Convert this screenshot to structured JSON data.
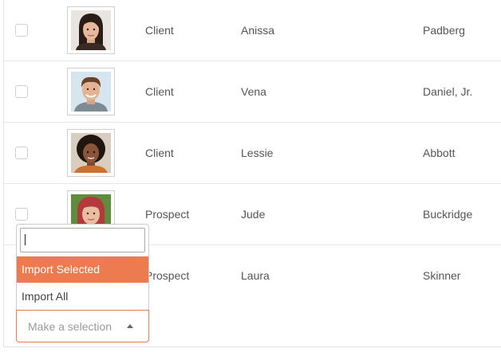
{
  "rows": [
    {
      "type": "Client",
      "first_name": "Anissa",
      "last_name": "Padberg",
      "photo": "woman-dark-hair-avatar"
    },
    {
      "type": "Client",
      "first_name": "Vena",
      "last_name": "Daniel, Jr.",
      "photo": "man-brown-hair-avatar"
    },
    {
      "type": "Client",
      "first_name": "Lessie",
      "last_name": "Abbott",
      "photo": "woman-curly-hair-avatar"
    },
    {
      "type": "Prospect",
      "first_name": "Jude",
      "last_name": "Buckridge",
      "photo": "woman-red-hair-avatar"
    },
    {
      "type": "Prospect",
      "first_name": "Laura",
      "last_name": "Skinner",
      "photo": ""
    }
  ],
  "dropdown": {
    "search_value": "",
    "options": [
      {
        "label": "Import Selected",
        "highlighted": true
      },
      {
        "label": "Import All",
        "highlighted": false
      }
    ],
    "placeholder": "Make a selection",
    "expanded": true
  },
  "colors": {
    "accent": "#ed7b50",
    "text": "#555555",
    "border": "#e6e6e6"
  }
}
